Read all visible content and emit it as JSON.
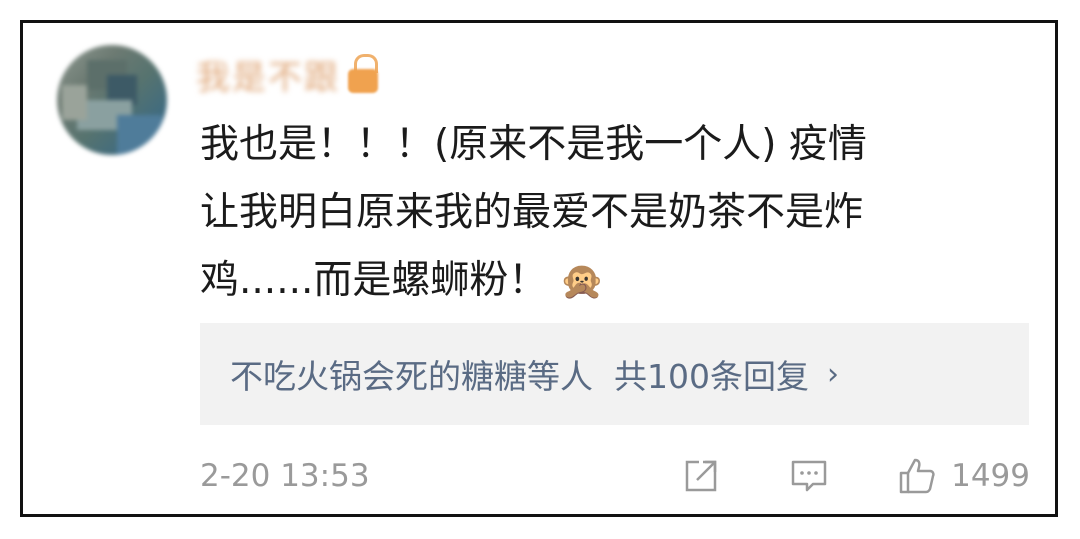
{
  "comment": {
    "username_blurred": "我是不跟",
    "lines": [
      "我也是！！！(原来不是我一个人) 疫情",
      "让我明白原来我的最爱不是奶茶不是炸",
      "鸡......而是螺蛳粉！"
    ],
    "emoji": "🙊"
  },
  "replies": {
    "link_text": "不吃火锅会死的糖糖等人  共100条回复",
    "chevron": "›"
  },
  "footer": {
    "timestamp": "2-20 13:53",
    "like_count": "1499"
  },
  "icons": [
    "avatar",
    "lock-icon",
    "share-icon",
    "comment-icon",
    "like-icon"
  ],
  "colors": {
    "link": "#5a6b84",
    "muted": "#9a9a9a",
    "reply_bg": "#f2f2f2"
  }
}
